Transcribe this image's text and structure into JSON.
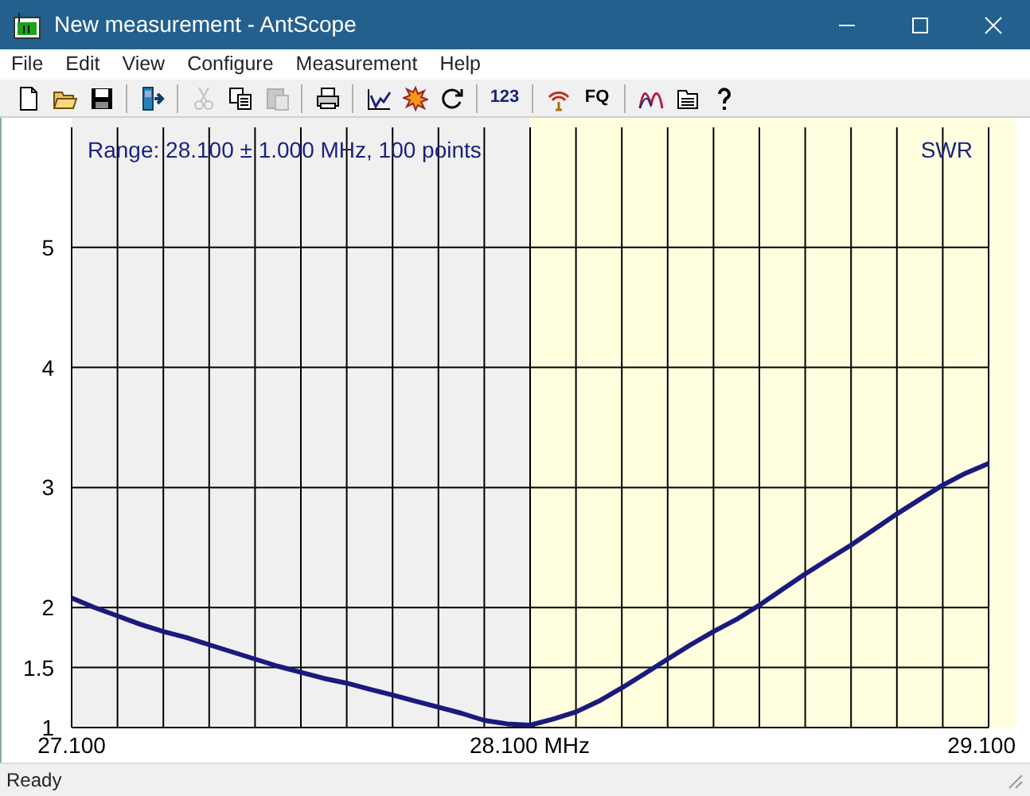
{
  "window": {
    "title": "New measurement - AntScope"
  },
  "menu": [
    {
      "label": "File"
    },
    {
      "label": "Edit"
    },
    {
      "label": "View"
    },
    {
      "label": "Configure"
    },
    {
      "label": "Measurement"
    },
    {
      "label": "Help"
    }
  ],
  "toolbar": [
    [
      {
        "disabled": false
      },
      {
        "disabled": false
      },
      {
        "disabled": false
      }
    ],
    [
      {
        "disabled": false
      }
    ],
    [
      {
        "disabled": true
      },
      {
        "disabled": false
      },
      {
        "disabled": true
      }
    ],
    [
      {
        "disabled": false
      }
    ],
    [
      {
        "disabled": false
      },
      {
        "disabled": false
      },
      {
        "disabled": false
      }
    ],
    [
      {
        "disabled": false,
        "label": "123"
      }
    ],
    [
      {
        "disabled": false
      },
      {
        "disabled": false,
        "label": "FQ"
      }
    ],
    [
      {
        "disabled": false
      },
      {
        "disabled": false
      },
      {
        "disabled": false
      }
    ]
  ],
  "chart": {
    "chart_data": {
      "type": "line",
      "grid": true,
      "ylabel": "SWR",
      "xlim": [
        27.1,
        29.1
      ],
      "ylim": [
        1,
        6
      ],
      "xticks": [
        {
          "value": 27.1,
          "label": "27.100"
        },
        {
          "value": 28.1,
          "label": "28.100 MHz"
        },
        {
          "value": 29.1,
          "label": "29.100"
        }
      ],
      "yticks": [
        {
          "value": 1,
          "label": "1"
        },
        {
          "value": 1.5,
          "label": "1.5"
        },
        {
          "value": 2,
          "label": "2"
        },
        {
          "value": 3,
          "label": "3"
        },
        {
          "value": 4,
          "label": "4"
        },
        {
          "value": 5,
          "label": "5"
        }
      ],
      "x": [
        27.1,
        27.15,
        27.2,
        27.25,
        27.3,
        27.35,
        27.4,
        27.45,
        27.5,
        27.55,
        27.6,
        27.65,
        27.7,
        27.75,
        27.8,
        27.85,
        27.9,
        27.95,
        28.0,
        28.05,
        28.1,
        28.15,
        28.2,
        28.25,
        28.3,
        28.35,
        28.4,
        28.45,
        28.5,
        28.55,
        28.6,
        28.65,
        28.7,
        28.75,
        28.8,
        28.85,
        28.9,
        28.95,
        29.0,
        29.05,
        29.1
      ],
      "series": [
        {
          "color": "#1a1a7e",
          "values": [
            2.08,
            2.0,
            1.93,
            1.86,
            1.8,
            1.75,
            1.69,
            1.63,
            1.57,
            1.51,
            1.46,
            1.41,
            1.37,
            1.32,
            1.27,
            1.22,
            1.17,
            1.12,
            1.06,
            1.03,
            1.02,
            1.07,
            1.13,
            1.22,
            1.33,
            1.45,
            1.57,
            1.69,
            1.8,
            1.9,
            2.02,
            2.15,
            2.28,
            2.4,
            2.52,
            2.65,
            2.78,
            2.9,
            3.02,
            3.12,
            3.2
          ]
        }
      ],
      "annotations": [
        "Range: 28.100 ± 1.000 MHz, 100 points"
      ]
    }
  },
  "status_bar": {
    "text": "Ready"
  }
}
